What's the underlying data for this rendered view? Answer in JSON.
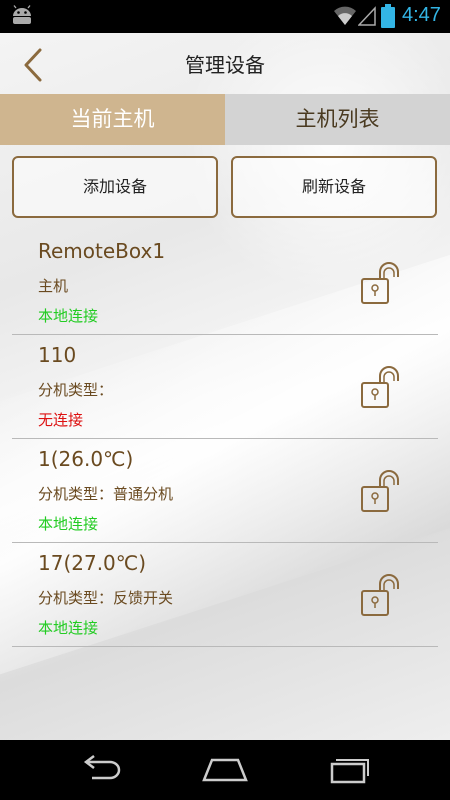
{
  "status_bar": {
    "time": "4:47",
    "icons": [
      "android-icon",
      "wifi-icon",
      "signal-icon",
      "battery-icon"
    ]
  },
  "header": {
    "title": "管理设备",
    "back_icon": "chevron-left-icon"
  },
  "tabs": [
    {
      "label": "当前主机",
      "active": true
    },
    {
      "label": "主机列表",
      "active": false
    }
  ],
  "actions": {
    "add_label": "添加设备",
    "refresh_label": "刷新设备"
  },
  "devices": [
    {
      "name": "RemoteBox1",
      "type": "主机",
      "connection": "本地连接",
      "connection_state": "local"
    },
    {
      "name": "110",
      "type": "分机类型：",
      "connection": "无连接",
      "connection_state": "none"
    },
    {
      "name": "1(26.0℃)",
      "type": "分机类型：普通分机",
      "connection": "本地连接",
      "connection_state": "local"
    },
    {
      "name": "17(27.0℃)",
      "type": "分机类型：反馈开关",
      "connection": "本地连接",
      "connection_state": "local"
    }
  ],
  "colors": {
    "accent": "#cfb58f",
    "text_brown": "#6a4a20",
    "local_green": "#22cc22",
    "none_red": "#dd1111",
    "clock_blue": "#33b5e5"
  },
  "nav": {
    "icons": [
      "back-nav-icon",
      "home-nav-icon",
      "recents-nav-icon"
    ]
  }
}
